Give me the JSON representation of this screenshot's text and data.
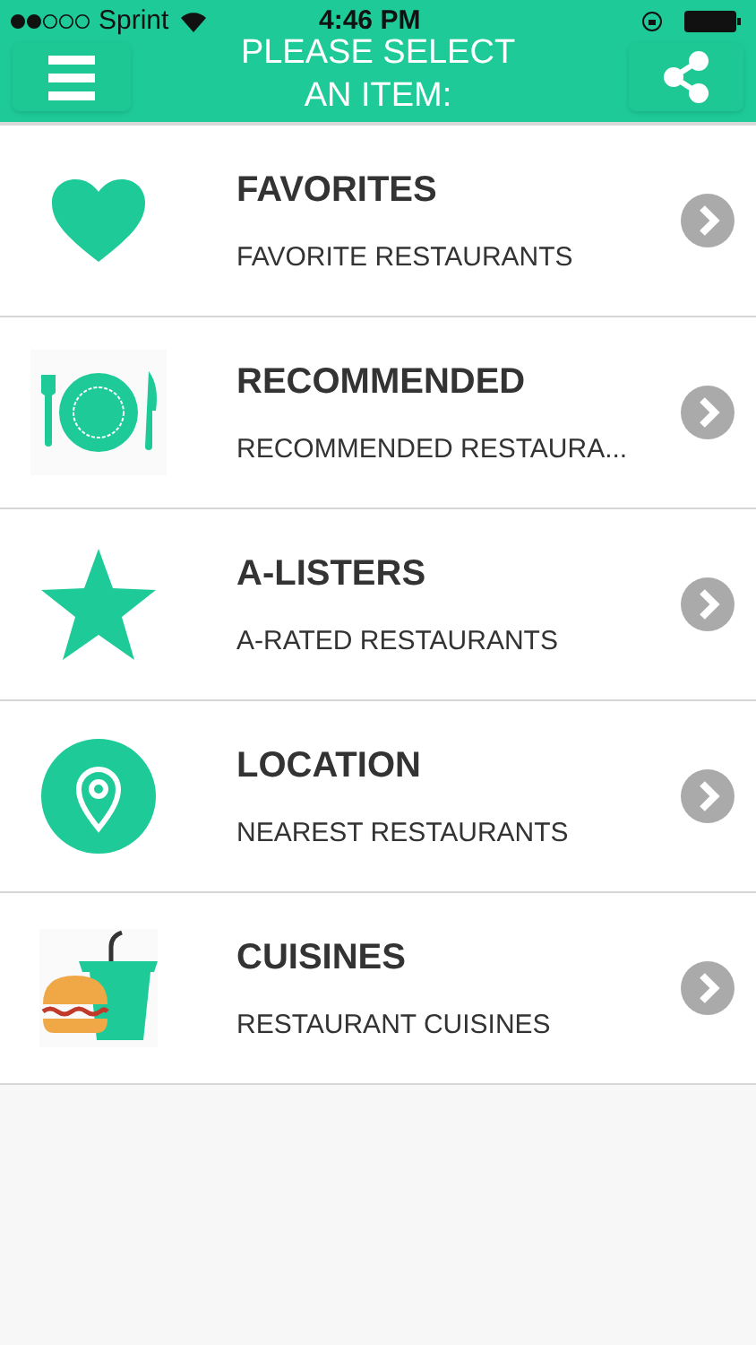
{
  "status_bar": {
    "carrier": "Sprint",
    "time": "4:46 PM"
  },
  "header": {
    "title": "PLEASE SELECT AN ITEM:"
  },
  "items": [
    {
      "kind": "heart",
      "title": "FAVORITES",
      "subtitle": "FAVORITE RESTAURANTS"
    },
    {
      "kind": "plate",
      "title": "RECOMMENDED",
      "subtitle": "RECOMMENDED RESTAURA..."
    },
    {
      "kind": "star",
      "title": "A-LISTERS",
      "subtitle": "A-RATED RESTAURANTS"
    },
    {
      "kind": "pin",
      "title": "LOCATION",
      "subtitle": "NEAREST RESTAURANTS"
    },
    {
      "kind": "food",
      "title": "CUISINES",
      "subtitle": "RESTAURANT CUISINES"
    }
  ]
}
